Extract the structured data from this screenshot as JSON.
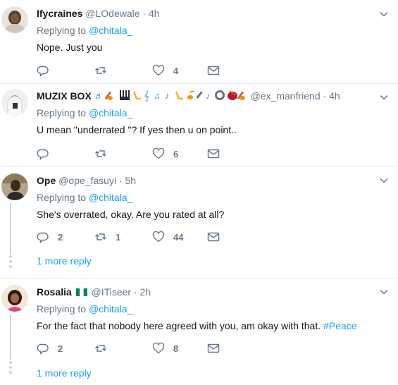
{
  "tweets": [
    {
      "name": "Ifycraines",
      "handle": "@LOdewale",
      "sep": "·",
      "time": "4h",
      "replying_prefix": "Replying to",
      "replying_to": "@chitala_",
      "text": "Nope.  Just you",
      "replies": "",
      "retweets": "",
      "likes": "4"
    },
    {
      "name": "MUZIX BOX",
      "handle": "@ex_manfriend",
      "sep": "·",
      "time": "4h",
      "replying_prefix": "Replying to",
      "replying_to": "@chitala_",
      "text": "U mean \"underrated \"?  If yes then u on point..",
      "replies": "",
      "retweets": "",
      "likes": "6"
    },
    {
      "name": "Ope",
      "handle": "@ope_fasuyi",
      "sep": "·",
      "time": "5h",
      "replying_prefix": "Replying to",
      "replying_to": "@chitala_",
      "text": "She's overrated, okay. Are you rated at all?",
      "replies": "2",
      "retweets": "1",
      "likes": "44",
      "more_replies": "1 more reply"
    },
    {
      "name": "Rosalia",
      "handle": "@ITiseer",
      "sep": "·",
      "time": "2h",
      "replying_prefix": "Replying to",
      "replying_to": "@chitala_",
      "text": "For the fact that nobody here agreed with you, am okay with that.",
      "hashtag": "#Peace",
      "replies": "2",
      "retweets": "",
      "likes": "8",
      "more_replies": "1 more reply"
    }
  ],
  "colors": {
    "link": "#1da1f2",
    "muted": "#657786",
    "divider": "#e6ecf0"
  },
  "icons": [
    "reply-icon",
    "retweet-icon",
    "like-icon",
    "direct-message-icon",
    "caret-down-icon"
  ]
}
